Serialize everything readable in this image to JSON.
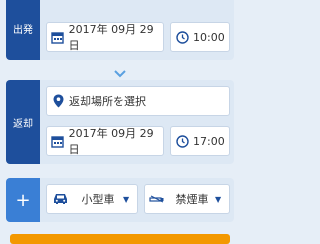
{
  "pickup": {
    "label": "出発",
    "date": "2017年 09月 29日",
    "time": "10:00"
  },
  "return": {
    "label": "返却",
    "location_placeholder": "返却場所を選択",
    "date": "2017年 09月 29日",
    "time": "17:00"
  },
  "options": {
    "add_label": "+",
    "car_size": "小型車",
    "smoking": "禁煙車"
  },
  "colors": {
    "primary": "#1e4f9c",
    "secondary": "#3a7fd5",
    "accent": "#f39800"
  }
}
